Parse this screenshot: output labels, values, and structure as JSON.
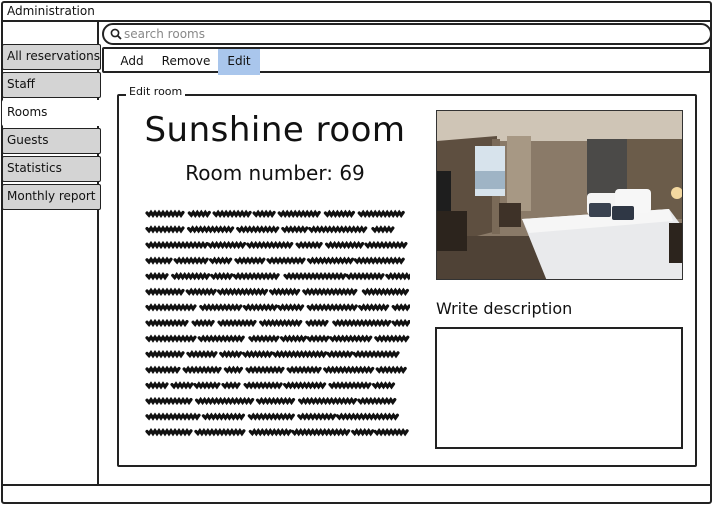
{
  "window": {
    "title": "Administration"
  },
  "search": {
    "placeholder": "search rooms",
    "value": ""
  },
  "sidebar": {
    "items": [
      {
        "label": "All reservations",
        "active": false
      },
      {
        "label": "Staff",
        "active": false
      },
      {
        "label": "Rooms",
        "active": true
      },
      {
        "label": "Guests",
        "active": false
      },
      {
        "label": "Statistics",
        "active": false
      },
      {
        "label": "Monthly report",
        "active": false
      }
    ]
  },
  "toolbar": {
    "add_label": "Add",
    "remove_label": "Remove",
    "edit_label": "Edit",
    "active": "Edit"
  },
  "editor": {
    "legend": "Edit room",
    "room_name": "Sunshine room",
    "room_number_label": "Room number: 69",
    "description_label": "Write description",
    "description_value": ""
  },
  "colors": {
    "active_tab": "#a9c6ec",
    "nav_inactive": "#d4d4d4",
    "border": "#222222"
  }
}
